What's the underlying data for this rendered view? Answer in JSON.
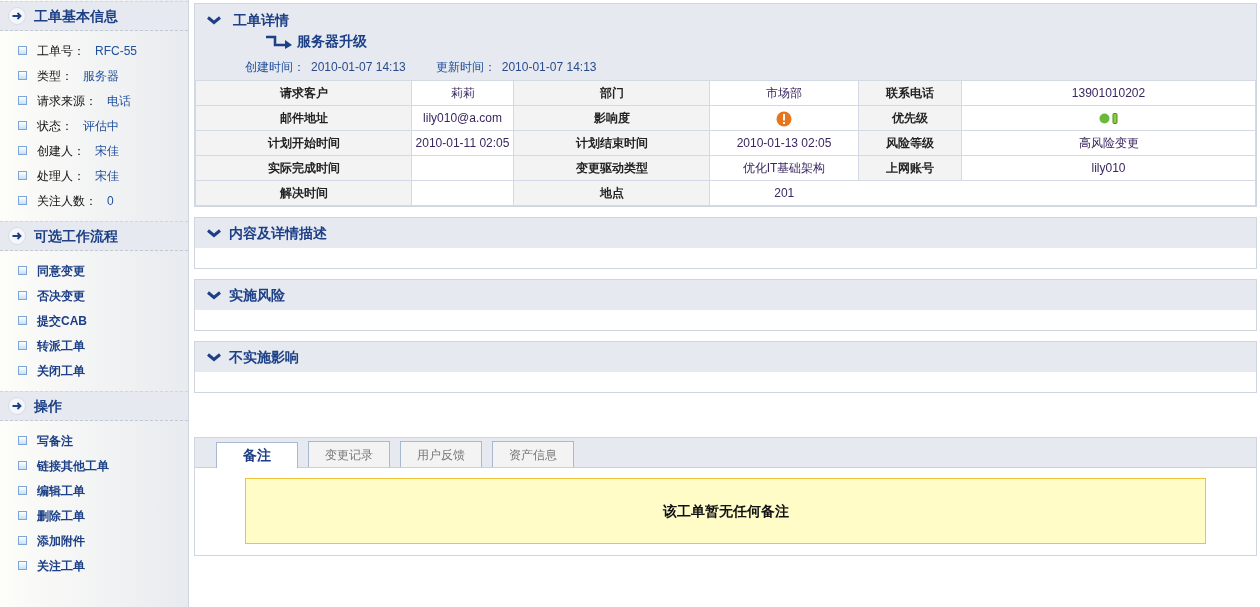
{
  "sidebar": {
    "sections": [
      {
        "title": "工单基本信息",
        "items": [
          {
            "kind": "field",
            "label": "工单号：",
            "value": "RFC-55"
          },
          {
            "kind": "field",
            "label": "类型：",
            "value": "服务器"
          },
          {
            "kind": "field",
            "label": "请求来源：",
            "value": "电话"
          },
          {
            "kind": "field",
            "label": "状态：",
            "value": "评估中"
          },
          {
            "kind": "field",
            "label": "创建人：",
            "value": "宋佳"
          },
          {
            "kind": "field",
            "label": "处理人：",
            "value": "宋佳"
          },
          {
            "kind": "field",
            "label": "关注人数：",
            "value": "0"
          }
        ]
      },
      {
        "title": "可选工作流程",
        "items": [
          {
            "kind": "link",
            "label": "同意变更"
          },
          {
            "kind": "link",
            "label": "否决变更"
          },
          {
            "kind": "link",
            "label": "提交CAB"
          },
          {
            "kind": "link",
            "label": "转派工单"
          },
          {
            "kind": "link",
            "label": "关闭工单"
          }
        ]
      },
      {
        "title": "操作",
        "items": [
          {
            "kind": "link",
            "label": "写备注"
          },
          {
            "kind": "link",
            "label": "链接其他工单"
          },
          {
            "kind": "link",
            "label": "编辑工单"
          },
          {
            "kind": "link",
            "label": "删除工单"
          },
          {
            "kind": "link",
            "label": "添加附件"
          },
          {
            "kind": "link",
            "label": "关注工单"
          }
        ]
      }
    ]
  },
  "detail": {
    "title": "工单详情",
    "subject": "服务器升级",
    "created_label": "创建时间：",
    "created": "2010-01-07 14:13",
    "updated_label": "更新时间：",
    "updated": "2010-01-07 14:13",
    "rows": [
      [
        {
          "kind": "label",
          "text": "请求客户"
        },
        {
          "kind": "text",
          "text": "莉莉"
        },
        {
          "kind": "label",
          "text": "部门"
        },
        {
          "kind": "text",
          "text": "市场部"
        },
        {
          "kind": "label",
          "text": "联系电话"
        },
        {
          "kind": "text",
          "text": "13901010202"
        }
      ],
      [
        {
          "kind": "label",
          "text": "邮件地址"
        },
        {
          "kind": "text",
          "text": "lily010@a.com"
        },
        {
          "kind": "label",
          "text": "影响度"
        },
        {
          "kind": "alert"
        },
        {
          "kind": "label",
          "text": "优先级"
        },
        {
          "kind": "signal"
        }
      ],
      [
        {
          "kind": "label",
          "text": "计划开始时间"
        },
        {
          "kind": "text",
          "text": "2010-01-11 02:05"
        },
        {
          "kind": "label",
          "text": "计划结束时间"
        },
        {
          "kind": "text",
          "text": "2010-01-13 02:05"
        },
        {
          "kind": "label",
          "text": "风险等级"
        },
        {
          "kind": "text",
          "text": "高风险变更"
        }
      ],
      [
        {
          "kind": "label",
          "text": "实际完成时间"
        },
        {
          "kind": "text",
          "text": ""
        },
        {
          "kind": "label",
          "text": "变更驱动类型"
        },
        {
          "kind": "text",
          "text": "优化IT基础架构"
        },
        {
          "kind": "label",
          "text": "上网账号"
        },
        {
          "kind": "text",
          "text": "lily010"
        }
      ],
      [
        {
          "kind": "label",
          "text": "解决时间"
        },
        {
          "kind": "text",
          "text": ""
        },
        {
          "kind": "label",
          "text": "地点"
        },
        {
          "kind": "wide",
          "text": "201"
        },
        {
          "kind": "blank"
        },
        {
          "kind": "blank"
        }
      ]
    ]
  },
  "panels": [
    {
      "title": "内容及详情描述"
    },
    {
      "title": "实施风险"
    },
    {
      "title": "不实施影响"
    }
  ],
  "tabs": [
    {
      "label": "备注",
      "selected": true
    },
    {
      "label": "变更记录",
      "selected": false
    },
    {
      "label": "用户反馈",
      "selected": false
    },
    {
      "label": "资产信息",
      "selected": false
    }
  ],
  "note": "该工单暂无任何备注"
}
